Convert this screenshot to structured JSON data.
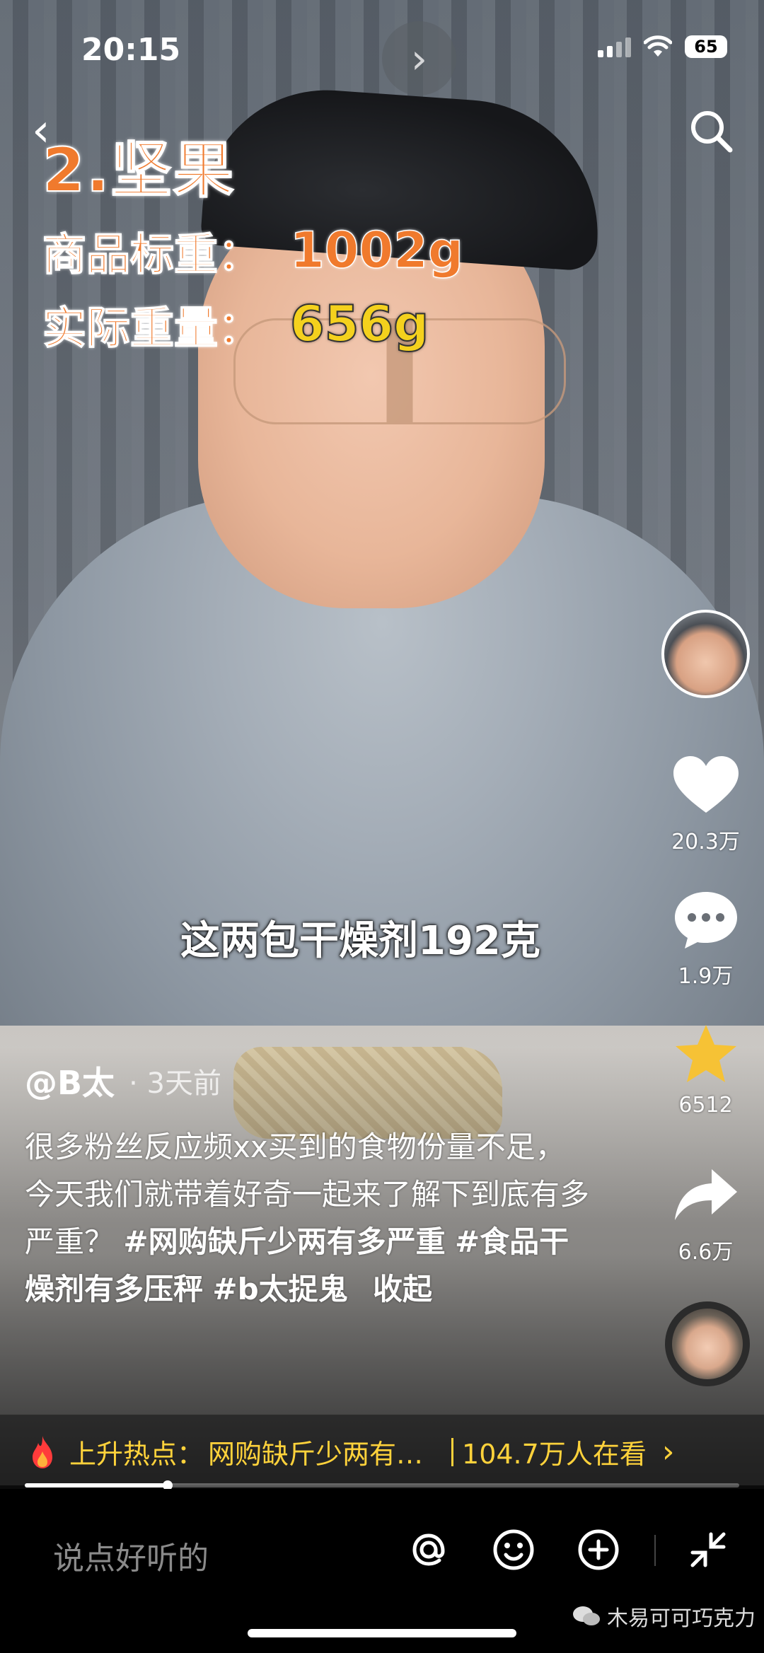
{
  "status_bar": {
    "time": "20:15",
    "battery": "65"
  },
  "video_overlay": {
    "title": "2.坚果",
    "line1_label": "商品标重：",
    "line1_value": "1002g",
    "line2_label": "实际重量：",
    "line2_value": "656g",
    "subtitle": "这两包干燥剂192克"
  },
  "actions": {
    "likes": "20.3万",
    "comments": "1.9万",
    "favorites": "6512",
    "shares": "6.6万"
  },
  "post": {
    "author": "@B太",
    "time": "· 3天前",
    "caption_text": "很多粉丝反应频xx买到的食物份量不足，今天我们就带着好奇一起来了解下到底有多严重？",
    "tags": [
      "#网购缺斤少两有多严重",
      "#食品干燥剂有多压秤",
      "#b太捉鬼"
    ],
    "fold_label": "收起"
  },
  "hot_topic": {
    "label": "上升热点：",
    "topic": "网购缺斤少两有…",
    "viewers": "104.7万人在看",
    "arrow": "›"
  },
  "comment_bar": {
    "placeholder": "说点好听的",
    "watermark": "木易可可巧克力"
  },
  "playback_progress": 0.2,
  "icons": [
    "back-icon",
    "search-icon",
    "next-icon",
    "heart-icon",
    "comment-icon",
    "star-icon",
    "share-icon",
    "fire-icon",
    "at-icon",
    "emoji-icon",
    "add-icon",
    "collapse-icon",
    "wechat-icon"
  ]
}
